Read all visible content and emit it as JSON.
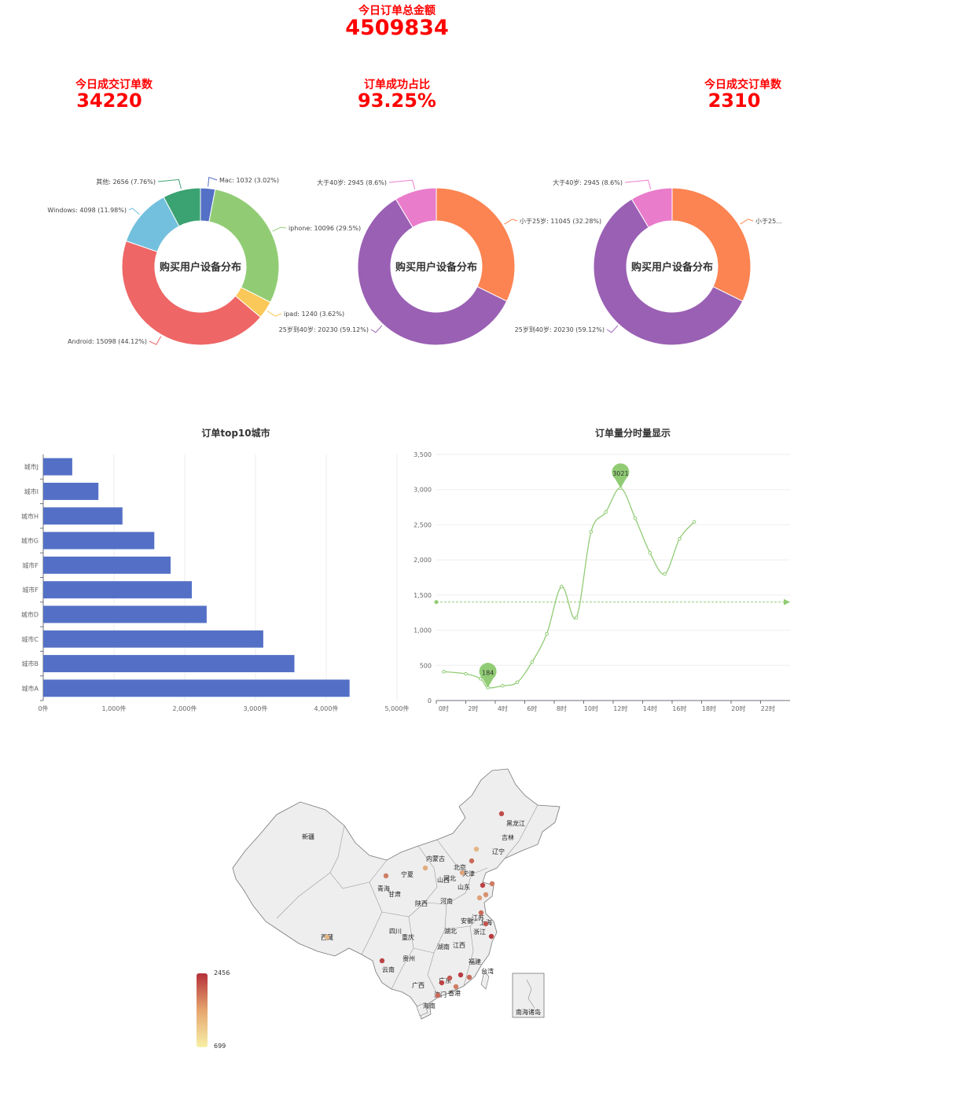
{
  "kpis": {
    "total": {
      "label": "今日订单总金额",
      "value": "4509834"
    },
    "left": {
      "label": "今日成交订单数",
      "value": "34220"
    },
    "mid": {
      "label": "订单成功占比",
      "value": "93.25%"
    },
    "right": {
      "label": "今日成交订单数",
      "value": "2310"
    }
  },
  "chart_data": [
    {
      "type": "pie",
      "title": "购买用户设备分布",
      "slices": [
        {
          "name": "Mac",
          "value": 1032,
          "pct": "3.02%",
          "color": "#5470c6",
          "label": "Mac: 1032 (3.02%)"
        },
        {
          "name": "iphone",
          "value": 10096,
          "pct": "29.5%",
          "color": "#91cc75",
          "label": "iphone: 10096 (29.5%)"
        },
        {
          "name": "ipad",
          "value": 1240,
          "pct": "3.62%",
          "color": "#fac858",
          "label": "ipad: 1240 (3.62%)"
        },
        {
          "name": "Android",
          "value": 15098,
          "pct": "44.12%",
          "color": "#ee6666",
          "label": "Android: 15098 (44.12%)"
        },
        {
          "name": "Windows",
          "value": 4098,
          "pct": "11.98%",
          "color": "#73c0de",
          "label": "Windows: 4098 (11.98%)"
        },
        {
          "name": "其他",
          "value": 2656,
          "pct": "7.76%",
          "color": "#3ba272",
          "label": "其他: 2656 (7.76%)"
        }
      ]
    },
    {
      "type": "pie",
      "title": "购买用户设备分布",
      "slices": [
        {
          "name": "小于25岁",
          "value": 11045,
          "pct": "32.28%",
          "color": "#fc8452",
          "label": "小于25岁: 11045 (32.28%)"
        },
        {
          "name": "25岁到40岁",
          "value": 20230,
          "pct": "59.12%",
          "color": "#9a60b4",
          "label": "25岁到40岁: 20230 (59.12%)"
        },
        {
          "name": "大于40岁",
          "value": 2945,
          "pct": "8.6%",
          "color": "#ea7ccc",
          "label": "大于40岁: 2945 (8.6%)"
        }
      ]
    },
    {
      "type": "pie",
      "title": "购买用户设备分布",
      "slices": [
        {
          "name": "小于25岁",
          "value": 11045,
          "pct": "32.28%",
          "color": "#fc8452",
          "label": "小于25..."
        },
        {
          "name": "25岁到40岁",
          "value": 20230,
          "pct": "59.12%",
          "color": "#9a60b4",
          "label": "25岁到40岁: 20230 (59.12%)"
        },
        {
          "name": "大于40岁",
          "value": 2945,
          "pct": "8.6%",
          "color": "#ea7ccc",
          "label": "大于40岁: 2945 (8.6%)"
        }
      ]
    },
    {
      "type": "bar",
      "orientation": "horizontal",
      "title": "订单top10城市",
      "categories": [
        "城市A",
        "城市B",
        "城市C",
        "城市D",
        "城市F",
        "城市F",
        "城市G",
        "城市H",
        "城市I",
        "城市J"
      ],
      "values": [
        4330,
        3550,
        3110,
        2310,
        2100,
        1800,
        1570,
        1120,
        780,
        410
      ],
      "xlim": [
        0,
        5000
      ],
      "xticks": [
        "0件",
        "1,000件",
        "2,000件",
        "3,000件",
        "4,000件",
        "5,000件"
      ],
      "color": "#5470c6"
    },
    {
      "type": "line",
      "title": "订单量分时量显示",
      "x": [
        0,
        1.5,
        2.5,
        3,
        4,
        5,
        6,
        7,
        8,
        9,
        10,
        11,
        12,
        13,
        14,
        15,
        16,
        17
      ],
      "values": [
        410,
        380,
        310,
        184,
        210,
        260,
        550,
        950,
        1620,
        1180,
        2400,
        2680,
        3021,
        2590,
        2100,
        1800,
        2300,
        2540
      ],
      "ylim": [
        0,
        3500
      ],
      "yticks": [
        "0",
        "500",
        "1,000",
        "1,500",
        "2,000",
        "2,500",
        "3,000",
        "3,500"
      ],
      "xticks": [
        "0时",
        "2时",
        "4时",
        "6时",
        "8时",
        "10时",
        "12时",
        "14时",
        "16时",
        "18时",
        "20时",
        "22时"
      ],
      "max": {
        "x": 12,
        "value": 3021,
        "label": "3021"
      },
      "min": {
        "x": 3,
        "value": 184,
        "label": "184"
      },
      "average": 1400,
      "color": "#91cc75"
    }
  ],
  "map": {
    "provinces": [
      "新疆",
      "西藏",
      "青海",
      "甘肃",
      "宁夏",
      "内蒙古",
      "黑龙江",
      "吉林",
      "辽宁",
      "北京",
      "天津",
      "河北",
      "山西",
      "山东",
      "陕西",
      "河南",
      "四川",
      "重庆",
      "湖北",
      "安徽",
      "江苏",
      "上海",
      "浙江",
      "湖南",
      "江西",
      "贵州",
      "云南",
      "福建",
      "台湾",
      "广西",
      "广东",
      "澳门",
      "香港",
      "海南",
      "南海诸岛"
    ],
    "legend_max": "2456",
    "legend_min": "699",
    "color_high": "#b5303a",
    "color_low": "#f7f0a6"
  }
}
